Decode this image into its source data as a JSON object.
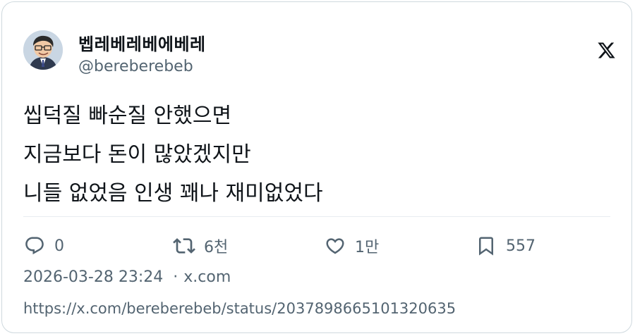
{
  "author": {
    "display_name": "벱레베레베에베레",
    "handle": "@bereberebeb",
    "avatar_icon": "user-avatar"
  },
  "brand": {
    "icon": "x-logo-icon"
  },
  "tweet": {
    "lines": [
      "씹덕질 빠순질 안했으면",
      "지금보다 돈이 많았겠지만",
      "니들 없었음 인생 꽤나 재미없었다"
    ]
  },
  "actions": {
    "reply": {
      "icon": "reply-icon",
      "count": "0"
    },
    "retweet": {
      "icon": "retweet-icon",
      "count": "6천"
    },
    "like": {
      "icon": "heart-icon",
      "count": "1만"
    },
    "bookmark": {
      "icon": "bookmark-icon",
      "count": "557"
    }
  },
  "meta": {
    "timestamp": "2026-03-28 23:24",
    "separator": "·",
    "source": "x.com"
  },
  "permalink": "https://x.com/bereberebeb/status/2037898665101320635",
  "colors": {
    "text": "#0f1419",
    "secondary": "#536471",
    "border": "#cfd9de"
  }
}
